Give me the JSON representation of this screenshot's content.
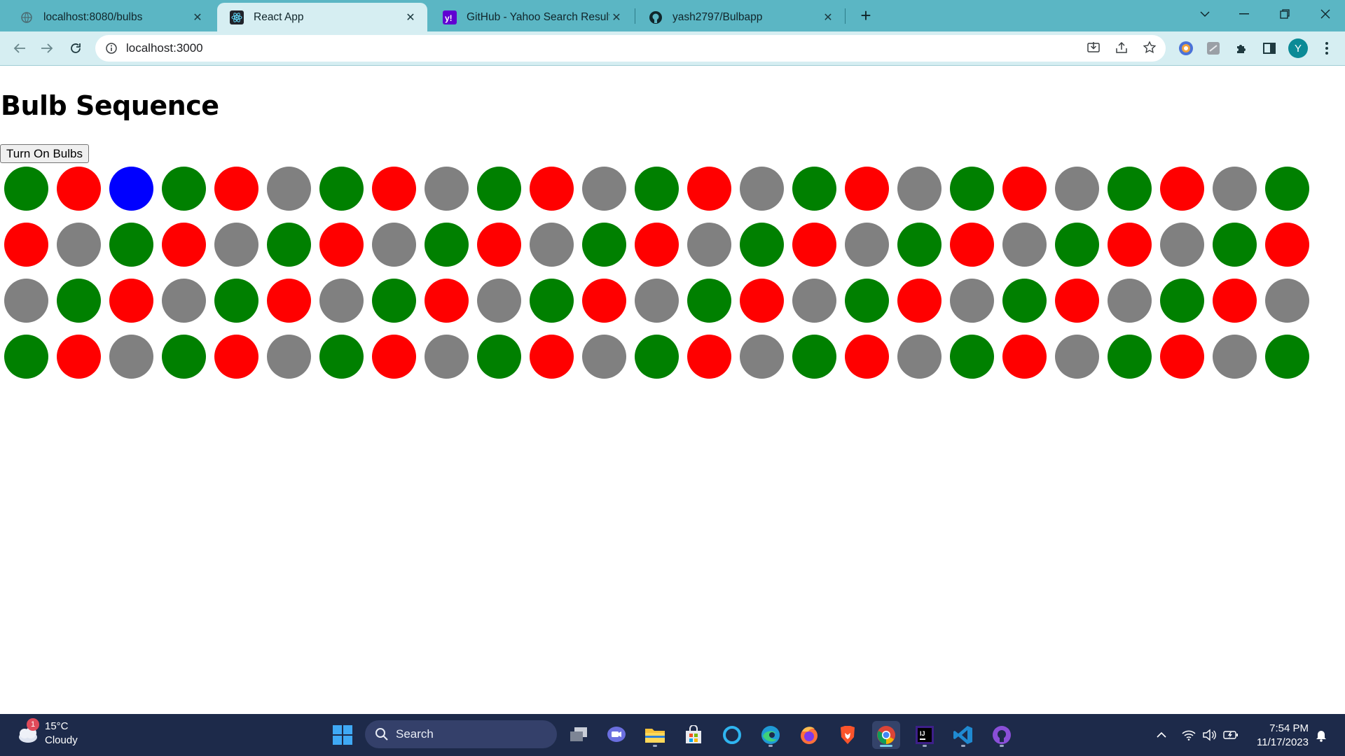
{
  "browser": {
    "tabs": [
      {
        "title": "localhost:8080/bulbs",
        "favicon": "globe-icon",
        "active": false
      },
      {
        "title": "React App",
        "favicon": "react-icon",
        "active": true
      },
      {
        "title": "GitHub - Yahoo Search Results",
        "favicon": "yahoo-icon",
        "active": false
      },
      {
        "title": "yash2797/Bulbapp",
        "favicon": "github-icon",
        "active": false
      }
    ],
    "new_tab_label": "+",
    "address": "localhost:3000",
    "profile_initial": "Y",
    "accent": "#5bb6c4"
  },
  "page": {
    "title": "Bulb Sequence",
    "button_label": "Turn On Bulbs",
    "bulb_colors": {
      "green": "#008000",
      "red": "#ff0000",
      "gray": "#808080",
      "blue": "#0000ff"
    },
    "bulb_rows": [
      [
        "green",
        "red",
        "blue",
        "green",
        "red",
        "gray",
        "green",
        "red",
        "gray",
        "green",
        "red",
        "gray",
        "green",
        "red",
        "gray",
        "green",
        "red",
        "gray",
        "green",
        "red",
        "gray",
        "green",
        "red",
        "gray",
        "green"
      ],
      [
        "red",
        "gray",
        "green",
        "red",
        "gray",
        "green",
        "red",
        "gray",
        "green",
        "red",
        "gray",
        "green",
        "red",
        "gray",
        "green",
        "red",
        "gray",
        "green",
        "red",
        "gray",
        "green",
        "red",
        "gray",
        "green",
        "red"
      ],
      [
        "gray",
        "green",
        "red",
        "gray",
        "green",
        "red",
        "gray",
        "green",
        "red",
        "gray",
        "green",
        "red",
        "gray",
        "green",
        "red",
        "gray",
        "green",
        "red",
        "gray",
        "green",
        "red",
        "gray",
        "green",
        "red",
        "gray"
      ],
      [
        "green",
        "red",
        "gray",
        "green",
        "red",
        "gray",
        "green",
        "red",
        "gray",
        "green",
        "red",
        "gray",
        "green",
        "red",
        "gray",
        "green",
        "red",
        "gray",
        "green",
        "red",
        "gray",
        "green",
        "red",
        "gray",
        "green"
      ]
    ]
  },
  "taskbar": {
    "weather_temp": "15°C",
    "weather_desc": "Cloudy",
    "weather_badge": "1",
    "search_label": "Search",
    "time": "7:54 PM",
    "date": "11/17/2023"
  }
}
